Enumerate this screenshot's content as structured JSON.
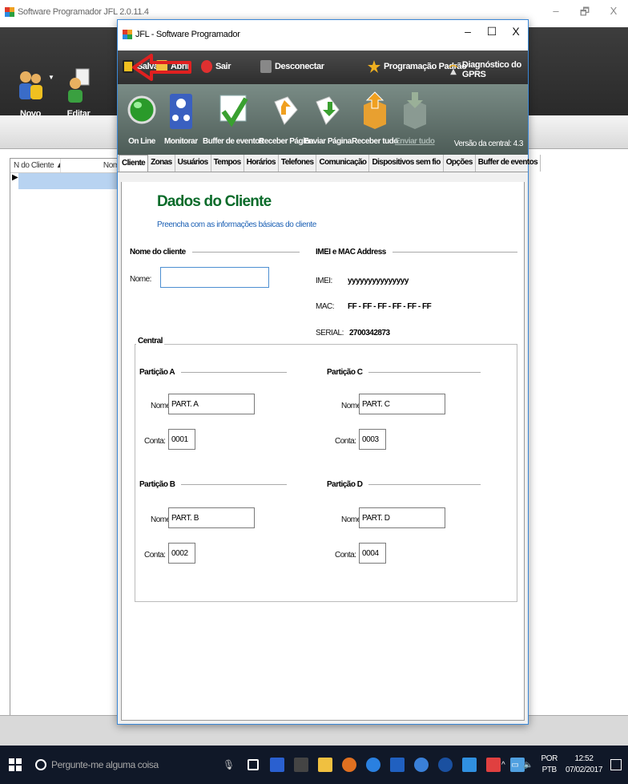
{
  "bg_window": {
    "title": "Software Programador JFL 2.0.11.4",
    "controls": {
      "minimize": "–",
      "restore": "🗗",
      "close": "X"
    },
    "tools": {
      "novo": "Novo",
      "editar": "Editar"
    },
    "list": {
      "col_num": "N do Cliente",
      "col_nome": "Nome"
    }
  },
  "dialog": {
    "title": "JFL - Software Programador",
    "controls": {
      "minimize": "–",
      "maximize": "☐",
      "close": "X"
    },
    "menu": {
      "salvar": "Salvar",
      "abrir": "Abrir",
      "sair": "Sair",
      "desconectar": "Desconectar",
      "programacao_padrao": "Programação Padrão",
      "diagnostico_gprs": "Diagnóstico do GPRS"
    },
    "toolbar": {
      "online": "On Line",
      "monitorar": "Monitorar",
      "buffer_eventos": "Buffer de eventos",
      "receber_pagina": "Receber Página",
      "enviar_pagina": "Enviar Página",
      "receber_tudo": "Receber tudo",
      "enviar_tudo": "Enviar tudo",
      "versao": "Versão da central: 4.3"
    },
    "tabs": [
      "Cliente",
      "Zonas",
      "Usuários",
      "Tempos",
      "Horários",
      "Telefones",
      "Comunicação",
      "Dispositivos sem fio",
      "Opções",
      "Buffer de eventos"
    ],
    "content": {
      "heading": "Dados do Cliente",
      "subheading": "Preencha com as informações básicas do cliente",
      "nome_cliente": {
        "title": "Nome do cliente",
        "label": "Nome:",
        "value": ""
      },
      "imei_mac": {
        "title": "IMEI e MAC Address",
        "imei_label": "IMEI:",
        "imei_value": "yyyyyyyyyyyyyyy",
        "mac_label": "MAC:",
        "mac_value": "FF - FF - FF - FF - FF - FF",
        "serial_label": "SERIAL:",
        "serial_value": "2700342873"
      },
      "central": {
        "title": "Central",
        "particoes": [
          {
            "title": "Partição A",
            "nome_label": "Nome:",
            "nome": "PART. A",
            "conta_label": "Conta:",
            "conta": "0001"
          },
          {
            "title": "Partição C",
            "nome_label": "Nome:",
            "nome": "PART. C",
            "conta_label": "Conta:",
            "conta": "0003"
          },
          {
            "title": "Partição B",
            "nome_label": "Nome:",
            "nome": "PART. B",
            "conta_label": "Conta:",
            "conta": "0002"
          },
          {
            "title": "Partição D",
            "nome_label": "Nome:",
            "nome": "PART. D",
            "conta_label": "Conta:",
            "conta": "0004"
          }
        ]
      }
    }
  },
  "taskbar": {
    "search_placeholder": "Pergunte-me alguma coisa",
    "lang_top": "POR",
    "lang_bottom": "PTB",
    "time": "12:52",
    "date": "07/02/2017"
  },
  "colors": {
    "heading_green": "#0a6b2a",
    "sub_blue": "#1a5fb4",
    "arrow_red": "#e02020",
    "toolbar_green": "#6a7c76"
  }
}
